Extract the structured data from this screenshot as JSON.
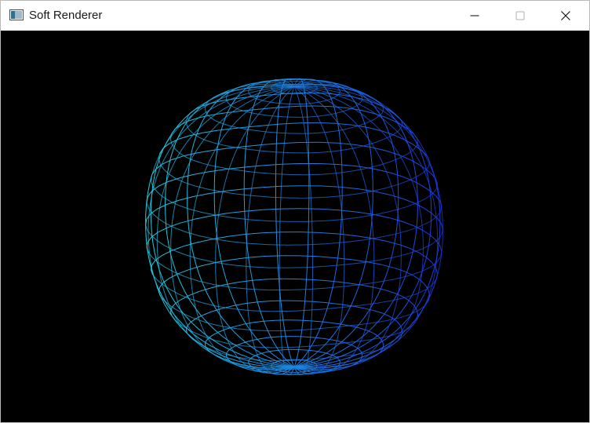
{
  "window": {
    "title": "Soft Renderer"
  },
  "icons": {
    "app": "app-window-icon",
    "minimize": "minimize-icon",
    "maximize": "maximize-icon",
    "close": "close-icon"
  },
  "colors": {
    "titlebar_bg": "#ffffff",
    "viewport_bg": "#000000",
    "wire_left": "#22cfe0",
    "wire_right": "#1c3adf"
  }
}
